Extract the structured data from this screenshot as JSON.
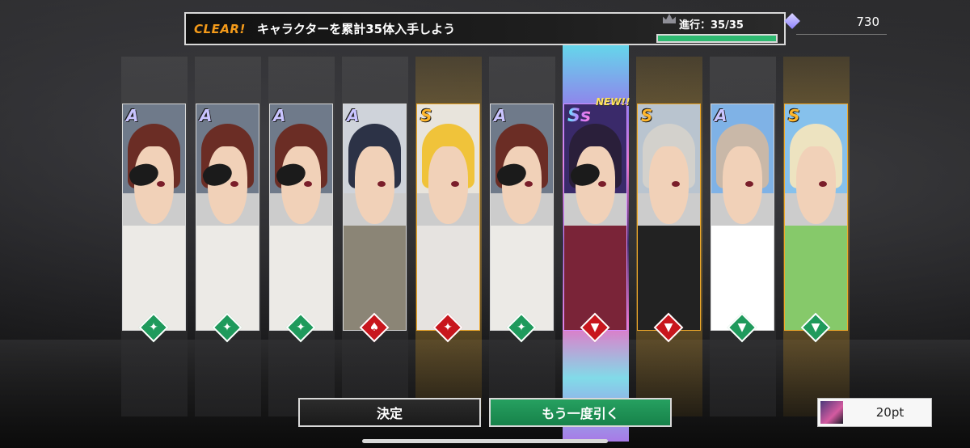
{
  "mission": {
    "status": "CLEAR!",
    "text": "キャラクターを累計35体入手しよう",
    "progress_label": "進行：35/35",
    "progress_fraction": 1.0
  },
  "currency": {
    "icon": "gem-icon",
    "value": "730"
  },
  "cards": [
    {
      "rank": "A",
      "rank_style": "a",
      "type": "green",
      "type_icon": "technique-icon",
      "frame": "silver",
      "is_new": false
    },
    {
      "rank": "A",
      "rank_style": "a",
      "type": "green",
      "type_icon": "technique-icon",
      "frame": "silver",
      "is_new": false
    },
    {
      "rank": "A",
      "rank_style": "a",
      "type": "green",
      "type_icon": "technique-icon",
      "frame": "silver",
      "is_new": false
    },
    {
      "rank": "A",
      "rank_style": "a",
      "type": "red",
      "type_icon": "power-icon",
      "frame": "silver",
      "is_new": false
    },
    {
      "rank": "S",
      "rank_style": "s",
      "type": "red",
      "type_icon": "technique-icon",
      "frame": "gold",
      "is_new": false
    },
    {
      "rank": "A",
      "rank_style": "a",
      "type": "green",
      "type_icon": "technique-icon",
      "frame": "silver",
      "is_new": false
    },
    {
      "rank": "Ss",
      "rank_style": "ss",
      "type": "red",
      "type_icon": "arrow-down-icon",
      "frame": "rainbow",
      "is_new": true
    },
    {
      "rank": "S",
      "rank_style": "s",
      "type": "red",
      "type_icon": "arrow-down-icon",
      "frame": "gold",
      "is_new": false
    },
    {
      "rank": "A",
      "rank_style": "a",
      "type": "green",
      "type_icon": "arrow-down-icon",
      "frame": "silver",
      "is_new": false
    },
    {
      "rank": "S",
      "rank_style": "s",
      "type": "green",
      "type_icon": "arrow-down-icon",
      "frame": "gold",
      "is_new": false
    }
  ],
  "new_label": "NEW!!",
  "buttons": {
    "confirm": "決定",
    "redraw": "もう一度引く"
  },
  "points": {
    "value": "20pt"
  },
  "colors": {
    "accent_green": "#1f9a5c",
    "accent_orange": "#f39a1a",
    "accent_red": "#c8161d"
  }
}
